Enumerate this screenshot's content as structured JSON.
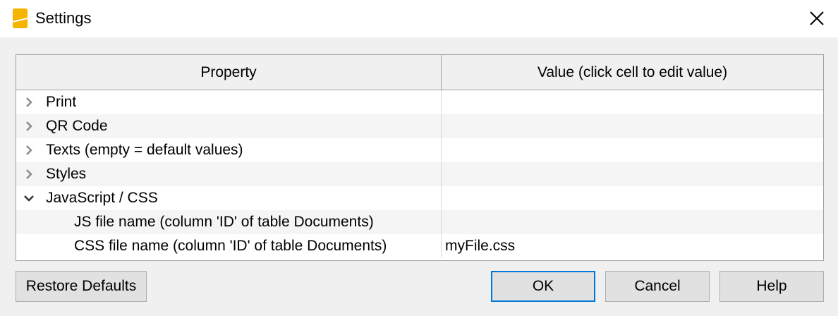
{
  "window": {
    "title": "Settings"
  },
  "table": {
    "headers": {
      "property": "Property",
      "value": "Value (click cell to edit value)"
    },
    "rows": [
      {
        "label": "Print",
        "value": "",
        "expandable": true,
        "expanded": false,
        "indent": 0
      },
      {
        "label": "QR Code",
        "value": "",
        "expandable": true,
        "expanded": false,
        "indent": 0
      },
      {
        "label": "Texts (empty = default values)",
        "value": "",
        "expandable": true,
        "expanded": false,
        "indent": 0
      },
      {
        "label": "Styles",
        "value": "",
        "expandable": true,
        "expanded": false,
        "indent": 0
      },
      {
        "label": "JavaScript / CSS",
        "value": "",
        "expandable": true,
        "expanded": true,
        "indent": 0
      },
      {
        "label": "JS file name (column 'ID' of table Documents)",
        "value": "",
        "expandable": false,
        "indent": 1
      },
      {
        "label": "CSS file name (column 'ID' of table Documents)",
        "value": "myFile.css",
        "expandable": false,
        "indent": 1
      }
    ]
  },
  "buttons": {
    "restore_defaults": "Restore Defaults",
    "ok": "OK",
    "cancel": "Cancel",
    "help": "Help"
  },
  "colors": {
    "app_icon": "#f5b400",
    "focus_border": "#0078d7",
    "button_bg": "#e1e1e1"
  },
  "icons": {
    "app": "app-logo-icon",
    "close": "close-icon",
    "collapsed": "chevron-right-icon",
    "expanded": "chevron-down-icon"
  }
}
